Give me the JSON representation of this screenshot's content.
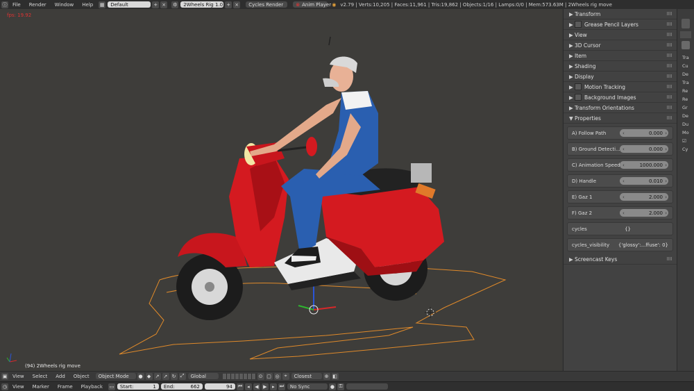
{
  "topbar": {
    "menus": [
      "File",
      "Render",
      "Window",
      "Help"
    ],
    "screen_layout": "Default",
    "scene": "2Wheels Rig 1.0",
    "render_engine": "Cycles Render",
    "anim_player": "Anim Player",
    "stats": "v2.79 | Verts:10,205 | Faces:11,961 | Tris:19,862 | Objects:1/16 | Lamps:0/0 | Mem:573.63M | 2Wheels rig move"
  },
  "viewport": {
    "fps": "fps: 19.92",
    "info": "(94) 2Wheels rig move"
  },
  "panel": {
    "sections_top": [
      {
        "label": "Transform",
        "checkbox": false
      },
      {
        "label": "Grease Pencil Layers",
        "checkbox": true
      },
      {
        "label": "View",
        "checkbox": false
      },
      {
        "label": "3D Cursor",
        "checkbox": false
      },
      {
        "label": "Item",
        "checkbox": false
      },
      {
        "label": "Shading",
        "checkbox": false
      },
      {
        "label": "Display",
        "checkbox": false
      },
      {
        "label": "Motion Tracking",
        "checkbox": true
      },
      {
        "label": "Background Images",
        "checkbox": true
      },
      {
        "label": "Transform Orientations",
        "checkbox": false
      }
    ],
    "properties_header": "Properties",
    "properties": [
      {
        "label": "A) Follow Path",
        "value": "0.000"
      },
      {
        "label": "B) Ground Detecti...",
        "value": "0.000"
      },
      {
        "label": "C) Animation Speed",
        "value": "1000.000"
      },
      {
        "label": "D) Handle",
        "value": "0.010"
      },
      {
        "label": "E) Gaz 1",
        "value": "2.000"
      },
      {
        "label": "F) Gaz 2",
        "value": "2.000"
      }
    ],
    "cycles_label": "cycles",
    "cycles_value": "{}",
    "cycles_visibility_label": "cycles_visibility",
    "cycles_visibility_value": "{'glossy':...ffuse': 0}",
    "screencast_keys": "Screencast Keys"
  },
  "right_strip": {
    "items": [
      "Tra",
      "Cu",
      "De",
      "Tra",
      "Re",
      "Re",
      "Gr",
      "De",
      "Du",
      "Mo",
      "",
      "Cy"
    ]
  },
  "toolbar3d": {
    "menus": [
      "View",
      "Select",
      "Add",
      "Object"
    ],
    "mode": "Object Mode",
    "orientation": "Global",
    "snap": "Closest"
  },
  "timeline": {
    "menus": [
      "View",
      "Marker",
      "Frame",
      "Playback"
    ],
    "start_label": "Start:",
    "start_value": "1",
    "end_label": "End:",
    "end_value": "662",
    "current_frame": "94",
    "sync": "No Sync"
  },
  "colors": {
    "scooter_red": "#d0191f",
    "overalls_blue": "#2a5fb0",
    "path_orange": "#e08a2a",
    "fps_red": "#dd3333"
  }
}
